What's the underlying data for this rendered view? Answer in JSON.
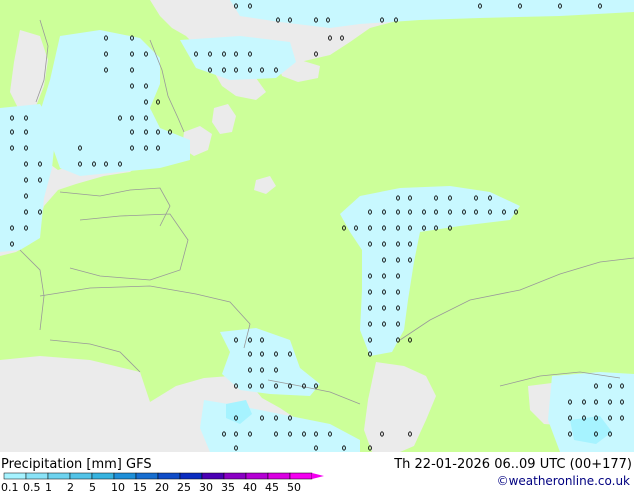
{
  "header": {
    "title": "Precipitation [mm] GFS",
    "datetime": "Th 22-01-2026 06..09 UTC (00+177)",
    "credit": "©weatheronline.co.uk"
  },
  "legend": {
    "labels": [
      "0.1",
      "0.5",
      "1",
      "2",
      "5",
      "10",
      "15",
      "20",
      "25",
      "30",
      "35",
      "40",
      "45",
      "50"
    ],
    "colors": [
      "#a6f3ff",
      "#8ae3f7",
      "#6ed3ef",
      "#52c3e7",
      "#36b3df",
      "#1e8fd8",
      "#176ed0",
      "#104dc8",
      "#0a2cc0",
      "#4a00b4",
      "#8a00c4",
      "#b400d4",
      "#da00e2",
      "#f400f0"
    ]
  },
  "colors": {
    "land": "#ccff99",
    "sea": "#ebebeb",
    "precip_light": "#c8f8ff",
    "precip_medium": "#a6f3ff",
    "precip_heavy": "#6ed3ef",
    "border": "#999999"
  }
}
